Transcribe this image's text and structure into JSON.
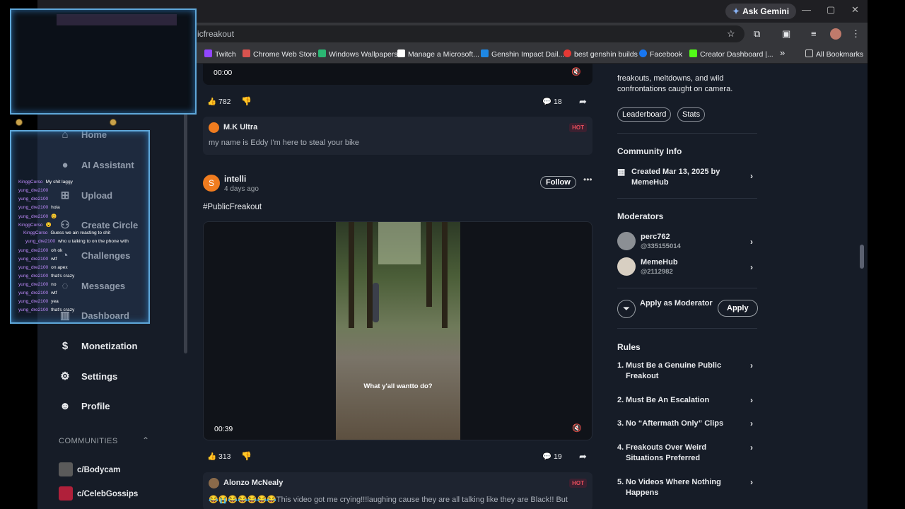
{
  "browser": {
    "gemini_label": "Ask Gemini",
    "url": "icfreakout",
    "bookmarks": [
      {
        "label": "Twitch",
        "color": "#9146ff"
      },
      {
        "label": "Chrome Web Store",
        "color": "#d9534f"
      },
      {
        "label": "Windows Wallpapers",
        "color": "#2bb673"
      },
      {
        "label": "Manage a Microsoft...",
        "color": "#ffffff"
      },
      {
        "label": "Genshin Impact Dail...",
        "color": "#1e88e5"
      },
      {
        "label": "best genshin builds",
        "color": "#e53935"
      },
      {
        "label": "Facebook",
        "color": "#1877f2"
      },
      {
        "label": "Creator Dashboard |...",
        "color": "#53fc18"
      }
    ],
    "more_label": "»",
    "all_bookmarks": "All Bookmarks"
  },
  "nav": {
    "items": [
      {
        "label": "Home",
        "icon": "home-icon"
      },
      {
        "label": "AI Assistant",
        "icon": "ai-icon"
      },
      {
        "label": "Upload",
        "icon": "upload-icon"
      },
      {
        "label": "Create Circle",
        "icon": "people-icon"
      },
      {
        "label": "Challenges",
        "icon": "chart-icon"
      },
      {
        "label": "Messages",
        "icon": "message-icon"
      },
      {
        "label": "Dashboard",
        "icon": "bars-icon"
      },
      {
        "label": "Monetization",
        "icon": "money-icon"
      },
      {
        "label": "Settings",
        "icon": "gear-icon"
      },
      {
        "label": "Profile",
        "icon": "profile-icon"
      }
    ],
    "communities_label": "COMMUNITIES",
    "communities": [
      {
        "label": "c/Bodycam"
      },
      {
        "label": "c/CelebGossips"
      }
    ]
  },
  "feed": {
    "top_video_time": "00:00",
    "post1": {
      "likes": "782",
      "comments": "18"
    },
    "comment1": {
      "user": "M.K Ultra",
      "text": "my name is Eddy I'm here to steal your bike",
      "badge": "HOT"
    },
    "post2": {
      "avatar_letter": "S",
      "user": "intelli",
      "time": "4 days ago",
      "follow_label": "Follow",
      "tag": "#PublicFreakout",
      "video_caption": "What y'all wantto do?",
      "video_time": "00:39",
      "likes": "313",
      "comments": "19"
    },
    "comment2": {
      "user": "Alonzo McNealy",
      "text": "😂😭😂😂😂😂😂This video got me crying!!!laughing cause they are all talking like they are Black!! But",
      "badge": "HOT"
    }
  },
  "sidebar": {
    "description": "freakouts, meltdowns, and wild confrontations caught on camera.",
    "chips": [
      "Leaderboard",
      "Stats"
    ],
    "community_info_title": "Community Info",
    "created": "Created Mar 13, 2025 by MemeHub",
    "moderators_title": "Moderators",
    "moderators": [
      {
        "name": "perc762",
        "id": "@335155014"
      },
      {
        "name": "MemeHub",
        "id": "@2112982"
      }
    ],
    "apply_moderator_label": "Apply as Moderator",
    "apply_label": "Apply",
    "rules_title": "Rules",
    "rules": [
      {
        "num": "1.",
        "text": "Must Be a Genuine Public Freakout"
      },
      {
        "num": "2.",
        "text": "Must Be An Escalation"
      },
      {
        "num": "3.",
        "text": "No “Aftermath Only” Clips"
      },
      {
        "num": "4.",
        "text": "Freakouts Over Weird Situations Preferred"
      },
      {
        "num": "5.",
        "text": "No Videos Where Nothing Happens"
      }
    ]
  },
  "chat": {
    "lines": [
      {
        "user": "KinggCorso",
        "msg": "My shit laggy"
      },
      {
        "user": "yung_dre2100",
        "msg": ""
      },
      {
        "user": "yung_dre2100",
        "msg": ""
      },
      {
        "user": "yung_dre2100",
        "msg": "hola"
      },
      {
        "user": "yung_dre2100",
        "msg": "😊"
      },
      {
        "user": "KinggCorso",
        "msg": "😮"
      },
      {
        "user": "KinggCorso",
        "msg": "Guess we ain reacting to shit"
      },
      {
        "user": "yung_dre2100",
        "msg": "who u talking to on the phone with"
      },
      {
        "user": "yung_dre2100",
        "msg": "oh ok"
      },
      {
        "user": "yung_dre2100",
        "msg": "wtf"
      },
      {
        "user": "yung_dre2100",
        "msg": "on apex"
      },
      {
        "user": "yung_dre2100",
        "msg": "that's crazy"
      },
      {
        "user": "yung_dre2100",
        "msg": "no"
      },
      {
        "user": "yung_dre2100",
        "msg": "wtf"
      },
      {
        "user": "yung_dre2100",
        "msg": "yea"
      },
      {
        "user": "yung_dre2100",
        "msg": "that's crazy"
      }
    ]
  }
}
